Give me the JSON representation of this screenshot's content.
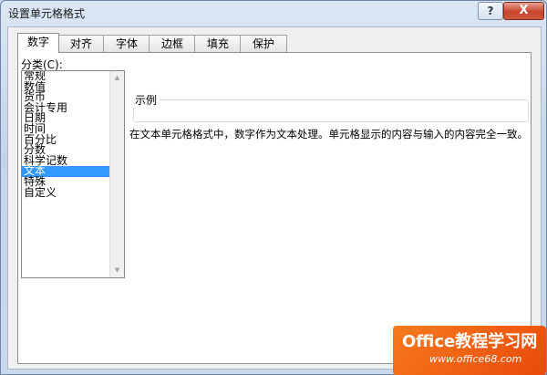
{
  "window": {
    "title": "设置单元格格式",
    "help_label": "?",
    "close_label": "X"
  },
  "tabs": [
    {
      "label": "数字",
      "active": true
    },
    {
      "label": "对齐",
      "active": false
    },
    {
      "label": "字体",
      "active": false
    },
    {
      "label": "边框",
      "active": false
    },
    {
      "label": "填充",
      "active": false
    },
    {
      "label": "保护",
      "active": false
    }
  ],
  "number_tab": {
    "category_label": "分类(C):",
    "categories": [
      "常规",
      "数值",
      "货币",
      "会计专用",
      "日期",
      "时间",
      "百分比",
      "分数",
      "科学记数",
      "文本",
      "特殊",
      "自定义"
    ],
    "selected_category": "文本",
    "sample_label": "示例",
    "description": "在文本单元格格式中，数字作为文本处理。单元格显示的内容与输入的内容完全一致。"
  },
  "watermark": {
    "title": "Office教程学习网",
    "url": "www.office68.com"
  },
  "colors": {
    "selection": "#3399ff",
    "close_button": "#c7442a",
    "watermark": "#f77a1e"
  }
}
